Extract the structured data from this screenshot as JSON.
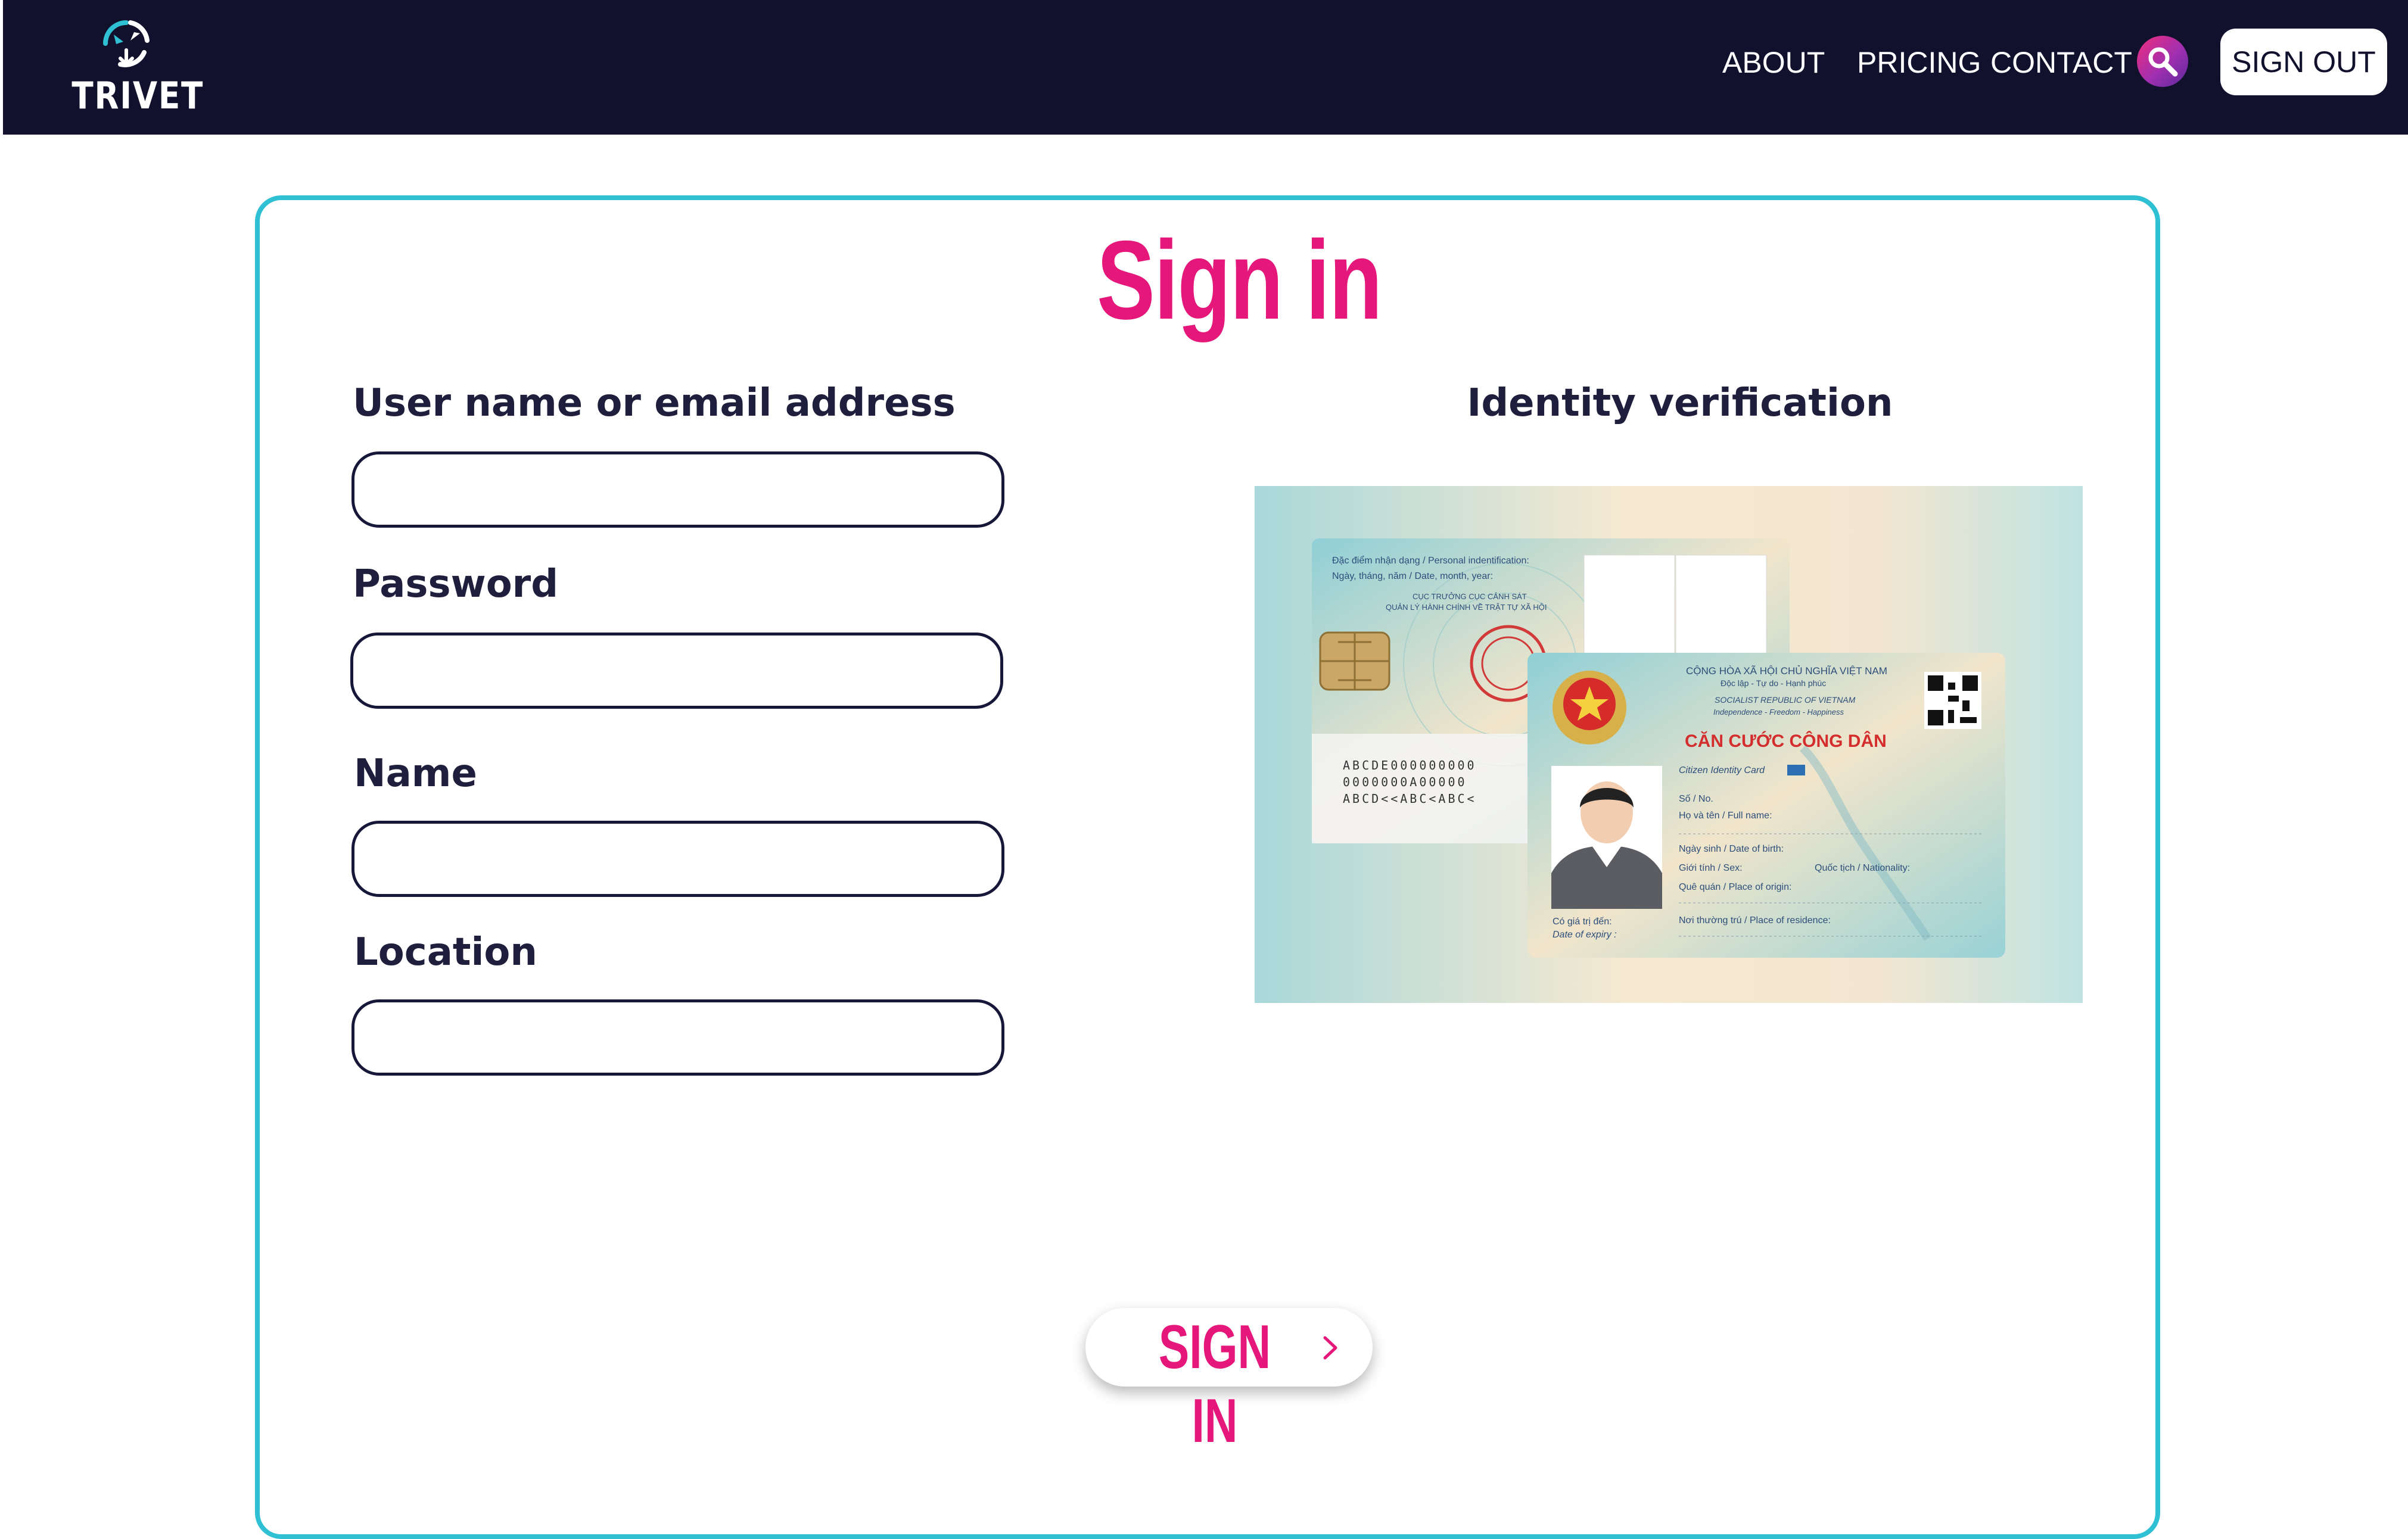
{
  "brand": {
    "name": "TRIVET"
  },
  "nav": {
    "about": "ABOUT",
    "pricing": "PRICING",
    "contact": "CONTACT",
    "search_icon": "search-icon",
    "sign_out": "SIGN OUT"
  },
  "form": {
    "title": "Sign in",
    "username": {
      "label": "User name or email address",
      "value": "",
      "placeholder": ""
    },
    "password": {
      "label": "Password",
      "value": "",
      "placeholder": ""
    },
    "name": {
      "label": "Name",
      "value": "",
      "placeholder": ""
    },
    "location": {
      "label": "Location",
      "value": "",
      "placeholder": ""
    },
    "submit_label": "SIGN IN",
    "submit_icon": "chevron-right-icon"
  },
  "identity": {
    "label": "Identity verification",
    "card_back": {
      "line1": "Đặc điểm nhận dạng / Personal indentification:",
      "line2": "Ngày, tháng, năm / Date, month, year:",
      "line3": "CỤC TRƯỞNG CỤC CẢNH SÁT",
      "line4": "QUẢN LÝ HÀNH CHÍNH VỀ TRẬT TỰ XÃ HỘI",
      "mrz1": "ABCDE000000000",
      "mrz2": "0000000A00000",
      "mrz3": "ABCD<<ABC<ABC<"
    },
    "card_front": {
      "country": "CỘNG HÒA XÃ HỘI CHỦ NGHĨA VIỆT NAM",
      "motto": "Độc lập - Tự do - Hạnh phúc",
      "country_en": "SOCIALIST REPUBLIC OF VIETNAM",
      "motto_en": "Independence - Freedom - Happiness",
      "card_title": "CĂN CƯỚC CÔNG DÂN",
      "card_subtitle": "Citizen Identity Card",
      "field_no": "Số / No.",
      "field_name": "Họ và tên / Full name:",
      "field_dob": "Ngày sinh / Date of birth:",
      "field_sex": "Giới tính / Sex:",
      "field_nationality": "Quốc tịch / Nationality:",
      "field_origin": "Quê quán / Place of origin:",
      "field_residence": "Nơi thường trú / Place of residence:",
      "field_expiry": "Có giá trị đến:",
      "field_expiry_en": "Date of expiry :"
    }
  },
  "colors": {
    "navbar": "#11112d",
    "accent_pink": "#e6177a",
    "card_border": "#2fc0d3",
    "label_text": "#1f1f3d",
    "search_gradient_start": "#ef2d7d",
    "search_gradient_end": "#5b2a9e"
  }
}
